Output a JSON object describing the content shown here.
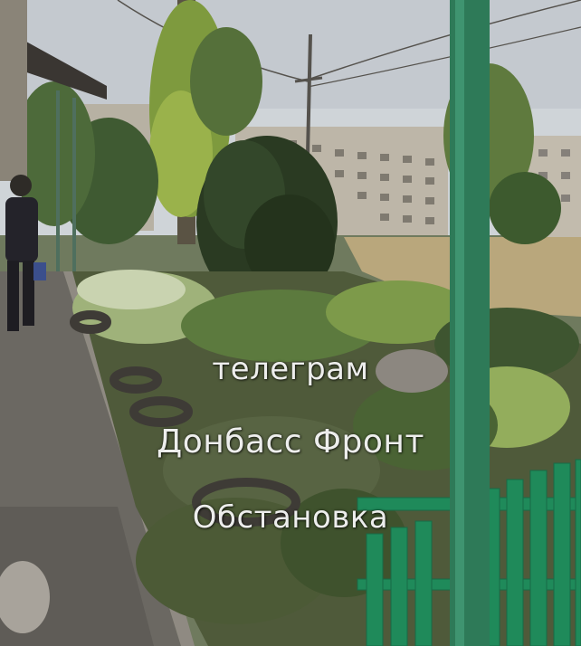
{
  "watermark": {
    "line1": "телеграм",
    "line2": "Донбасс Фронт",
    "line3": "Обстановка"
  },
  "colors": {
    "sky": "#c9ced3",
    "building": "#b9b3a6",
    "foliage_dark": "#2f3d25",
    "foliage_light": "#7f9b4d",
    "grass_dry": "#b8a57a",
    "fence": "#1f8a5a",
    "pole": "#2e7d5a",
    "path": "#6d6a64"
  }
}
